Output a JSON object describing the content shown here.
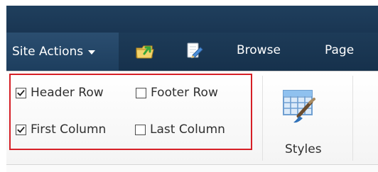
{
  "top_nav": {
    "site_actions_label": "Site Actions",
    "tabs": [
      {
        "label": "Browse"
      },
      {
        "label": "Page"
      }
    ],
    "icons": [
      {
        "name": "upload-folder-icon"
      },
      {
        "name": "edit-page-icon"
      }
    ]
  },
  "ribbon": {
    "table_style_options": [
      {
        "label": "Header Row",
        "checked": true
      },
      {
        "label": "Footer Row",
        "checked": false
      },
      {
        "label": "First Column",
        "checked": true
      },
      {
        "label": "Last Column",
        "checked": false
      }
    ],
    "styles_button_label": "Styles"
  },
  "colors": {
    "top_bar": "#1f3f5d",
    "site_actions_bg": "#2b4e70",
    "highlight_border": "#d61f26",
    "ribbon_bg": "#f7f7f7"
  }
}
